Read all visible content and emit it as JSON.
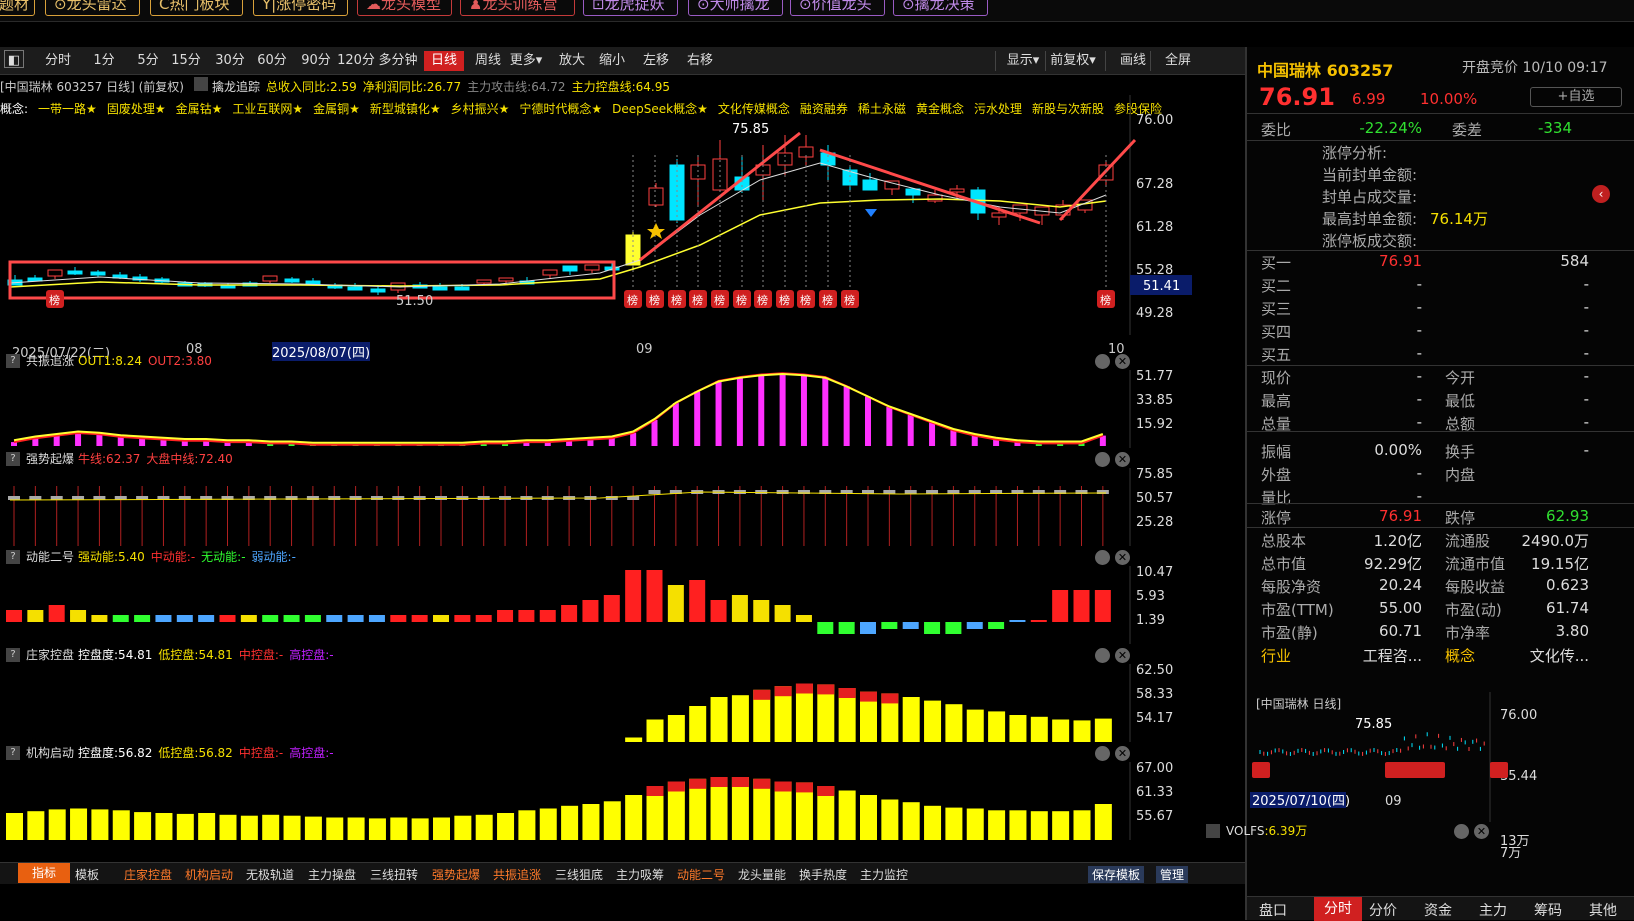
{
  "top_buttons": [
    {
      "label": "题材",
      "color": "gold"
    },
    {
      "label": "⊙龙头雷达",
      "color": "gold"
    },
    {
      "label": "C热门板块",
      "color": "gold"
    },
    {
      "label": "Y|涨停密码",
      "color": "gold"
    },
    {
      "label": "☁龙头模型",
      "color": "red"
    },
    {
      "label": "♟龙头训练营",
      "color": "red"
    },
    {
      "label": "⊡龙虎捉妖",
      "color": "purple"
    },
    {
      "label": "⊙大师擒龙",
      "color": "purple"
    },
    {
      "label": "⊙价值龙头",
      "color": "purple"
    },
    {
      "label": "⊙擒龙决策",
      "color": "purple"
    }
  ],
  "toolbar": {
    "items": [
      "分时",
      "1分",
      "5分",
      "15分",
      "30分",
      "60分",
      "90分",
      "120分",
      "多分钟",
      "日线",
      "周线",
      "更多▾",
      "放大",
      "缩小",
      "左移",
      "右移"
    ],
    "active": "日线",
    "right": [
      "显示▾",
      "前复权▾",
      "画线",
      "全屏"
    ]
  },
  "info_line": {
    "title": "[中国瑞林 603257 日线] (前复权)",
    "indicator": "擒龙追踪",
    "income": "总收入同比:2.59",
    "profit": "净利润同比:26.77",
    "attack": "主力攻击线:64.72",
    "control": "主力控盘线:64.95"
  },
  "concepts": {
    "prefix": "概念:",
    "items": [
      "一带一路★",
      "固废处理★",
      "金属钴★",
      "工业互联网★",
      "金属铜★",
      "新型城镇化★",
      "乡村振兴★",
      "宁德时代概念★",
      "DeepSeek概念★",
      "文化传媒概念",
      "融资融券",
      "稀土永磁",
      "黄金概念",
      "污水处理",
      "新股与次新股",
      "参股保险"
    ]
  },
  "main_chart": {
    "y_labels": [
      "76.00",
      "67.28",
      "61.28",
      "55.28",
      "49.28"
    ],
    "current_price": "51.41",
    "high_label": "75.85",
    "low_label": "51.50",
    "bang": "榜"
  },
  "date_axis": {
    "labels": [
      "2025/07/22(二)",
      "08",
      "2025/08/07(四)",
      "09",
      "10"
    ]
  },
  "panels": [
    {
      "title": "共振追涨",
      "l1": "OUT1:8.24",
      "l2": "OUT2:3.80",
      "labels": [
        "51.77",
        "33.85",
        "15.92"
      ]
    },
    {
      "title": "强势起爆",
      "l1": "牛线:62.37",
      "l2": "大盘中线:72.40",
      "labels": [
        "75.85",
        "50.57",
        "25.28"
      ]
    },
    {
      "title": "动能二号",
      "l1": "强动能:5.40",
      "l2": "中动能:-",
      "l3": "无动能:-",
      "l4": "弱动能:-",
      "labels": [
        "10.47",
        "5.93",
        "1.39"
      ]
    },
    {
      "title": "庄家控盘",
      "l1": "控盘度:54.81",
      "l2": "低控盘:54.81",
      "l3": "中控盘:-",
      "l4": "高控盘:-",
      "labels": [
        "62.50",
        "58.33",
        "54.17"
      ]
    },
    {
      "title": "机构启动",
      "l1": "控盘度:56.82",
      "l2": "低控盘:56.82",
      "l3": "中控盘:-",
      "l4": "高控盘:-",
      "labels": [
        "67.00",
        "61.33",
        "55.67"
      ]
    }
  ],
  "bottom_tabs": [
    "指标",
    "模板",
    "庄家控盘",
    "机构启动",
    "无极轨道",
    "主力操盘",
    "三线扭转",
    "强势起爆",
    "共振追涨",
    "三线狙底",
    "主力吸筹",
    "动能二号",
    "龙头量能",
    "换手热度",
    "主力监控"
  ],
  "bottom_right": [
    "保存模板",
    "管理"
  ],
  "quote": {
    "name": "中国瑞林 603257",
    "auction": "开盘竞价 10/10 09:17",
    "price": "76.91",
    "change": "6.99",
    "pct": "10.00%",
    "watch": "+自选",
    "webi_label": "委比",
    "webi": "-22.24%",
    "weicha_label": "委差",
    "weicha": "-334",
    "limit_rows": [
      [
        "涨停分析:",
        ""
      ],
      [
        "当前封单金额:",
        ""
      ],
      [
        "封单占成交量:",
        ""
      ],
      [
        "最高封单金额:",
        "76.14万"
      ],
      [
        "涨停板成交额:",
        ""
      ]
    ],
    "buy": [
      [
        "买一",
        "76.91",
        "584"
      ],
      [
        "买二",
        "-",
        "-"
      ],
      [
        "买三",
        "-",
        "-"
      ],
      [
        "买四",
        "-",
        "-"
      ],
      [
        "买五",
        "-",
        "-"
      ]
    ],
    "stats": [
      [
        "现价",
        "-",
        "今开",
        "-"
      ],
      [
        "最高",
        "-",
        "最低",
        "-"
      ],
      [
        "总量",
        "-",
        "总额",
        "-"
      ],
      [
        "振幅",
        "0.00%",
        "换手",
        "-"
      ],
      [
        "外盘",
        "-",
        "内盘",
        ""
      ],
      [
        "量比",
        "-",
        "",
        ""
      ]
    ],
    "limits": [
      [
        "涨停",
        "76.91",
        "跌停",
        "62.93"
      ]
    ],
    "fund": [
      [
        "总股本",
        "1.20亿",
        "流通股",
        "2490.0万"
      ],
      [
        "总市值",
        "92.29亿",
        "流通市值",
        "19.15亿"
      ],
      [
        "每股净资",
        "20.24",
        "每股收益",
        "0.623"
      ],
      [
        "市盈(TTM)",
        "55.00",
        "市盈(动)",
        "61.74"
      ],
      [
        "市盈(静)",
        "60.71",
        "市净率",
        "3.80"
      ],
      [
        "行业",
        "工程咨...",
        "概念",
        "文化传..."
      ]
    ]
  },
  "mini": {
    "title": "[中国瑞林 日线]",
    "high": "75.85",
    "y1": "76.00",
    "y2": "35.44",
    "date": "2025/07/10(四)",
    "m": "09",
    "vol": "VOLFS",
    "vol_val": ":6.39万",
    "vol_axis": "13万",
    "vol_axis2": "7万"
  },
  "right_tabs": [
    "盘口",
    "分时",
    "分价",
    "资金",
    "主力",
    "筹码",
    "其他"
  ]
}
